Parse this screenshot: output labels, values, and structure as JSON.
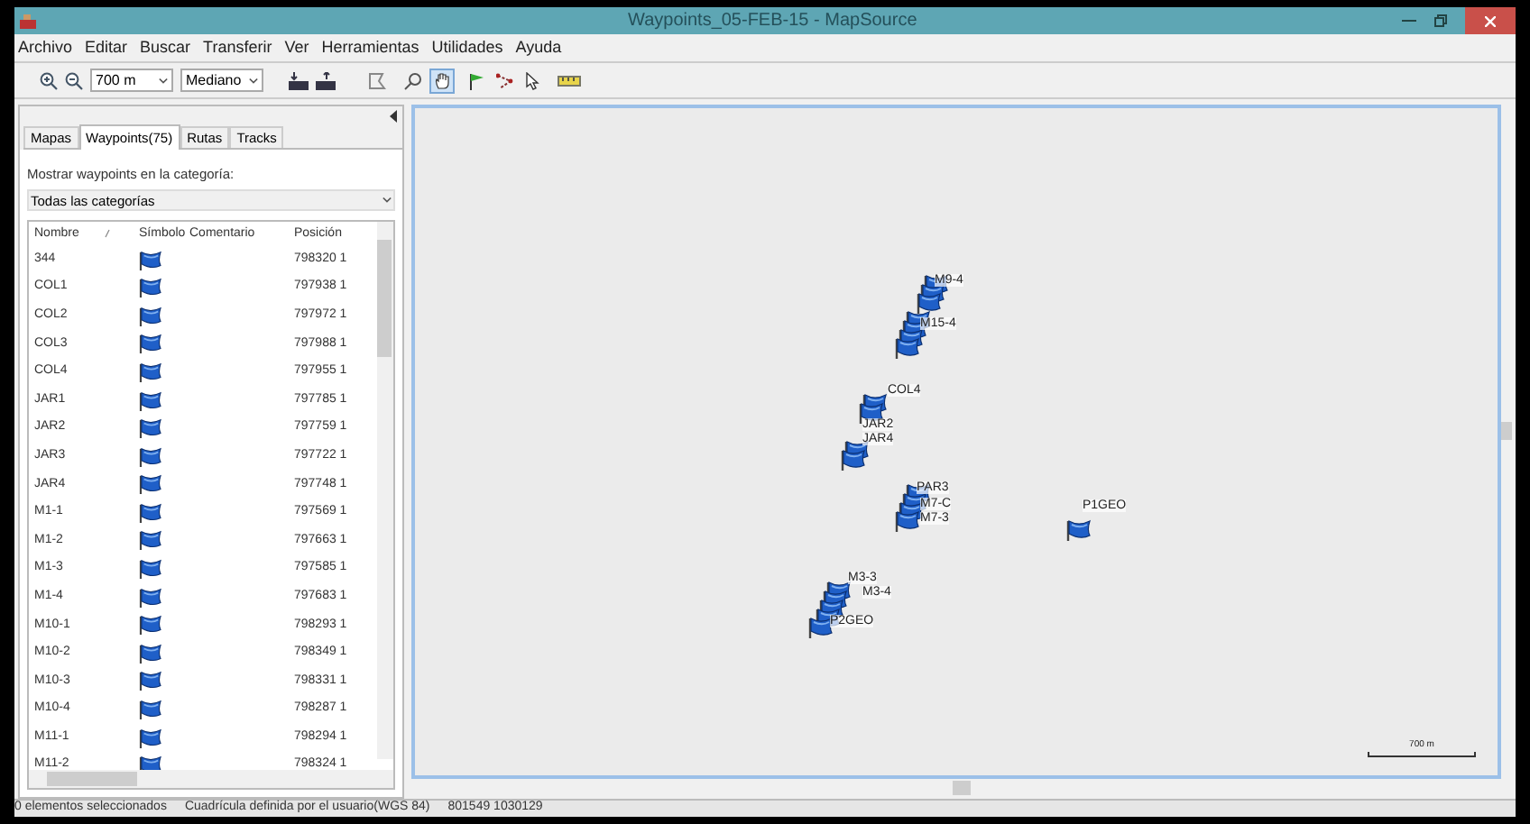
{
  "window": {
    "title": "Waypoints_05-FEB-15 - MapSource"
  },
  "menu": [
    "Archivo",
    "Editar",
    "Buscar",
    "Transferir",
    "Ver",
    "Herramientas",
    "Utilidades",
    "Ayuda"
  ],
  "toolbar": {
    "zoom": "700 m",
    "detail": "Mediano"
  },
  "tabs": [
    {
      "label": "Mapas",
      "selected": false
    },
    {
      "label": "Waypoints(75)",
      "selected": true
    },
    {
      "label": "Rutas",
      "selected": false
    },
    {
      "label": "Tracks",
      "selected": false
    }
  ],
  "category": {
    "label": "Mostrar waypoints en la categoría:",
    "value": "Todas las categorías"
  },
  "table": {
    "columns": [
      "Nombre",
      "Símbolo",
      "Comentario",
      "Posición"
    ],
    "rows": [
      {
        "name": "344",
        "position": "798320 1"
      },
      {
        "name": "COL1",
        "position": "797938 1"
      },
      {
        "name": "COL2",
        "position": "797972 1"
      },
      {
        "name": "COL3",
        "position": "797988 1"
      },
      {
        "name": "COL4",
        "position": "797955 1"
      },
      {
        "name": "JAR1",
        "position": "797785 1"
      },
      {
        "name": "JAR2",
        "position": "797759 1"
      },
      {
        "name": "JAR3",
        "position": "797722 1"
      },
      {
        "name": "JAR4",
        "position": "797748 1"
      },
      {
        "name": "M1-1",
        "position": "797569 1"
      },
      {
        "name": "M1-2",
        "position": "797663 1"
      },
      {
        "name": "M1-3",
        "position": "797585 1"
      },
      {
        "name": "M1-4",
        "position": "797683 1"
      },
      {
        "name": "M10-1",
        "position": "798293 1"
      },
      {
        "name": "M10-2",
        "position": "798349 1"
      },
      {
        "name": "M10-3",
        "position": "798331 1"
      },
      {
        "name": "M10-4",
        "position": "798287 1"
      },
      {
        "name": "M11-1",
        "position": "798294 1"
      },
      {
        "name": "M11-2",
        "position": "798324 1"
      }
    ]
  },
  "map": {
    "labels": [
      "M9-4",
      "M15-4",
      "COL4",
      "JAR2",
      "JAR4",
      "PAR3",
      "M7-C",
      "M7-3",
      "P1GEO",
      "M3-3",
      "M3-4",
      "P2GEO"
    ],
    "scale": "700 m"
  },
  "status_bar": [
    "0 elementos seleccionados",
    "Cuadrícula definida por el usuario(WGS 84)",
    "801549 1030129"
  ]
}
